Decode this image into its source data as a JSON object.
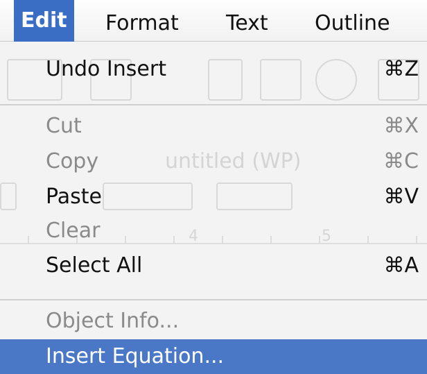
{
  "menubar": {
    "items": [
      {
        "label": "Edit",
        "active": true
      },
      {
        "label": "Format",
        "active": false
      },
      {
        "label": "Text",
        "active": false
      },
      {
        "label": "Outline",
        "active": false
      }
    ]
  },
  "background_window": {
    "title": "untitled (WP)",
    "ruler_numbers": [
      "4",
      "5"
    ]
  },
  "edit_menu": {
    "items": [
      {
        "label": "Undo Insert",
        "shortcut": "⌘Z",
        "state": "enabled"
      },
      {
        "label": "Cut",
        "shortcut": "⌘X",
        "state": "disabled"
      },
      {
        "label": "Copy",
        "shortcut": "⌘C",
        "state": "disabled"
      },
      {
        "label": "Paste",
        "shortcut": "⌘V",
        "state": "enabled"
      },
      {
        "label": "Clear",
        "shortcut": "",
        "state": "disabled"
      },
      {
        "label": "Select All",
        "shortcut": "⌘A",
        "state": "enabled"
      },
      {
        "label": "Object Info...",
        "shortcut": "",
        "state": "disabled"
      },
      {
        "label": "Insert Equation...",
        "shortcut": "",
        "state": "highlighted"
      }
    ]
  },
  "colors": {
    "highlight": "#4b78c6",
    "active_menu": "#3a6ec5",
    "disabled_text": "#8a8a8a"
  }
}
